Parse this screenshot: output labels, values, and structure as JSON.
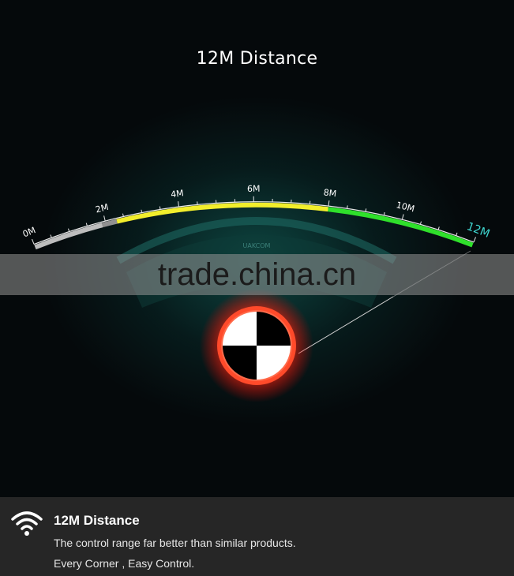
{
  "hero": {
    "title": "12M Distance",
    "scale": {
      "min": 0,
      "max": 12,
      "labels": [
        "0M",
        "2M",
        "4M",
        "6M",
        "8M",
        "10M",
        "12M"
      ],
      "segments": [
        {
          "from": 0,
          "to": 1.9,
          "color": "#bdbdbd"
        },
        {
          "from": 1.9,
          "to": 2.3,
          "color": "#909090"
        },
        {
          "from": 2.3,
          "to": 8,
          "color": "#f2ee2c"
        },
        {
          "from": 8,
          "to": 12,
          "color": "#2fe02b"
        }
      ],
      "highlight_label_color": "#3fd6d0",
      "label_color": "#ffffff"
    },
    "device_label": "UAKCOM",
    "target_colors": {
      "glow": "#ff3a1a",
      "fill": "#000000",
      "light": "#ffffff"
    }
  },
  "watermark": "trade.china.cn",
  "footer": {
    "icon": "wifi-icon",
    "title": "12M Distance",
    "line1": "The control range far better than similar products.",
    "line2": "Every Corner , Easy Control."
  }
}
